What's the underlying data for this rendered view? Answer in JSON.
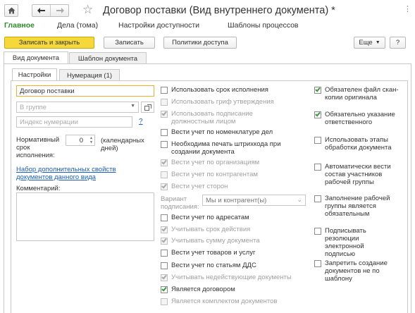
{
  "window": {
    "title": "Договор поставки (Вид внутреннего документа) *",
    "home_icon": "home-icon",
    "back_icon": "arrow-left-icon",
    "forward_icon": "arrow-right-icon",
    "favorite_icon": "star-icon",
    "menu_icon": "more-icon"
  },
  "nav": {
    "items": [
      "Главное",
      "Дела (тома)",
      "Настройки доступности",
      "Шаблоны процессов"
    ],
    "active": "Главное"
  },
  "toolbar": {
    "save_close": "Записать и закрыть",
    "save": "Записать",
    "access_policies": "Политики доступа",
    "more": "Еще",
    "help": "?"
  },
  "outer_tabs": [
    "Вид документа",
    "Шаблон документа"
  ],
  "inner_tabs": [
    "Настройки",
    "Нумерация (1)"
  ],
  "form": {
    "name_value": "Договор поставки",
    "group_placeholder": "В группе",
    "index_placeholder": "Индекс нумерации",
    "help_mark": "?",
    "term_label": "Нормативный срок исполнения:",
    "term_value": "0",
    "term_units": "(календарных дней)",
    "extra_props_link": "Набор дополнительных свойств документов данного вида",
    "comment_label": "Комментарий:",
    "variant_label": "Вариант подписания:",
    "variant_value": "Мы и контрагент(ы)"
  },
  "middle_checks": [
    {
      "label": "Использовать срок исполнения",
      "checked": false,
      "disabled": false
    },
    {
      "label": "Использовать гриф утверждения",
      "checked": false,
      "disabled": true
    },
    {
      "label": "Использовать подписание должностным лицом",
      "checked": true,
      "disabled": true
    },
    {
      "label": "Вести учет по номенклатуре дел",
      "checked": false,
      "disabled": false
    },
    {
      "label": "Необходима печать штрихкода при создании документа",
      "checked": false,
      "disabled": false
    },
    {
      "label": "Вести учет по организациям",
      "checked": true,
      "disabled": true
    },
    {
      "label": "Вести учет по контрагентам",
      "checked": false,
      "disabled": true
    },
    {
      "label": "Вести учет сторон",
      "checked": true,
      "disabled": true
    },
    {
      "label": "Вести учет по адресатам",
      "checked": false,
      "disabled": false
    },
    {
      "label": "Учитывать срок действия",
      "checked": true,
      "disabled": true
    },
    {
      "label": "Учитывать сумму документа",
      "checked": true,
      "disabled": true
    },
    {
      "label": "Вести учет товаров и услуг",
      "checked": false,
      "disabled": false
    },
    {
      "label": "Вести учет по статьям ДДС",
      "checked": false,
      "disabled": false
    },
    {
      "label": "Учитывать недействующие документы",
      "checked": true,
      "disabled": true
    },
    {
      "label": "Является договором",
      "checked": true,
      "disabled": false
    },
    {
      "label": "Является комплектом документов",
      "checked": false,
      "disabled": true
    }
  ],
  "right_checks": [
    {
      "label": "Обязателен файл скан-копии оригинала",
      "checked": true,
      "disabled": false
    },
    {
      "label": "Обязательно указание ответственного",
      "checked": true,
      "disabled": false
    },
    {
      "label": "Использовать этапы обработки документа",
      "checked": false,
      "disabled": false
    },
    {
      "label": "Автоматически вести состав участников рабочей группы",
      "checked": false,
      "disabled": false
    },
    {
      "label": "Заполнение рабочей группы является обязательным",
      "checked": false,
      "disabled": false
    },
    {
      "label": "Подписывать резолюции электронной подписью",
      "checked": false,
      "disabled": false
    },
    {
      "label": "Запретить создание документов не по шаблону",
      "checked": false,
      "disabled": false
    }
  ],
  "colors": {
    "accent_green": "#2d8a2d",
    "primary_button": "#f5d93b",
    "link_blue": "#1a5fb4",
    "focus_border": "#e8b030"
  }
}
